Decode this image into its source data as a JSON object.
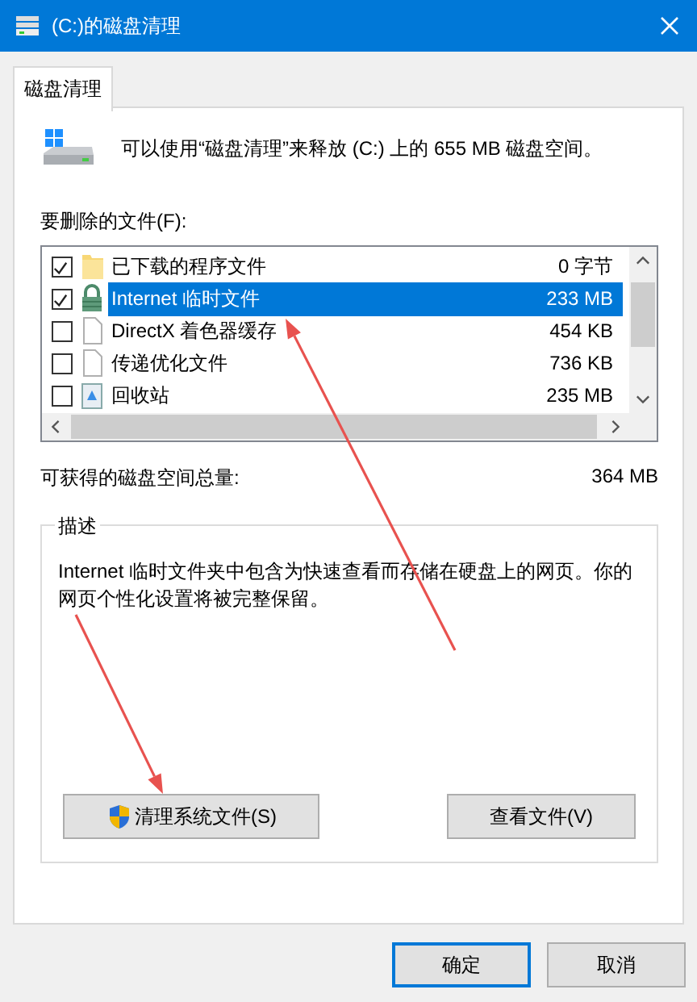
{
  "window": {
    "title": "(C:)的磁盘清理"
  },
  "tabs": [
    {
      "label": "磁盘清理",
      "selected": true
    }
  ],
  "summary": "可以使用“磁盘清理”来释放 (C:) 上的 655 MB 磁盘空间。",
  "files_label": "要删除的文件(F):",
  "files": [
    {
      "name": "已下载的程序文件",
      "size": "0 字节",
      "checked": true,
      "selected": false,
      "kind": "folder"
    },
    {
      "name": "Internet 临时文件",
      "size": "233 MB",
      "checked": true,
      "selected": true,
      "kind": "lock"
    },
    {
      "name": "DirectX 着色器缓存",
      "size": "454 KB",
      "checked": false,
      "selected": false,
      "kind": "document"
    },
    {
      "name": "传递优化文件",
      "size": "736 KB",
      "checked": false,
      "selected": false,
      "kind": "document"
    },
    {
      "name": "回收站",
      "size": "235 MB",
      "checked": false,
      "selected": false,
      "kind": "recycle"
    }
  ],
  "total": {
    "label": "可获得的磁盘空间总量:",
    "value": "364 MB"
  },
  "description": {
    "title": "描述",
    "text": "Internet 临时文件夹中包含为快速查看而存储在硬盘上的网页。你的网页个性化设置将被完整保留。"
  },
  "buttons": [
    {
      "label": "清理系统文件(S)",
      "kind": "shield"
    },
    {
      "label": "查看文件(V)",
      "kind": "plain"
    }
  ],
  "dialog_buttons": [
    {
      "label": "确定",
      "default": true
    },
    {
      "label": "取消",
      "default": false
    }
  ],
  "annotations": [
    {
      "kind": "arrow"
    },
    {
      "kind": "arrow"
    }
  ]
}
